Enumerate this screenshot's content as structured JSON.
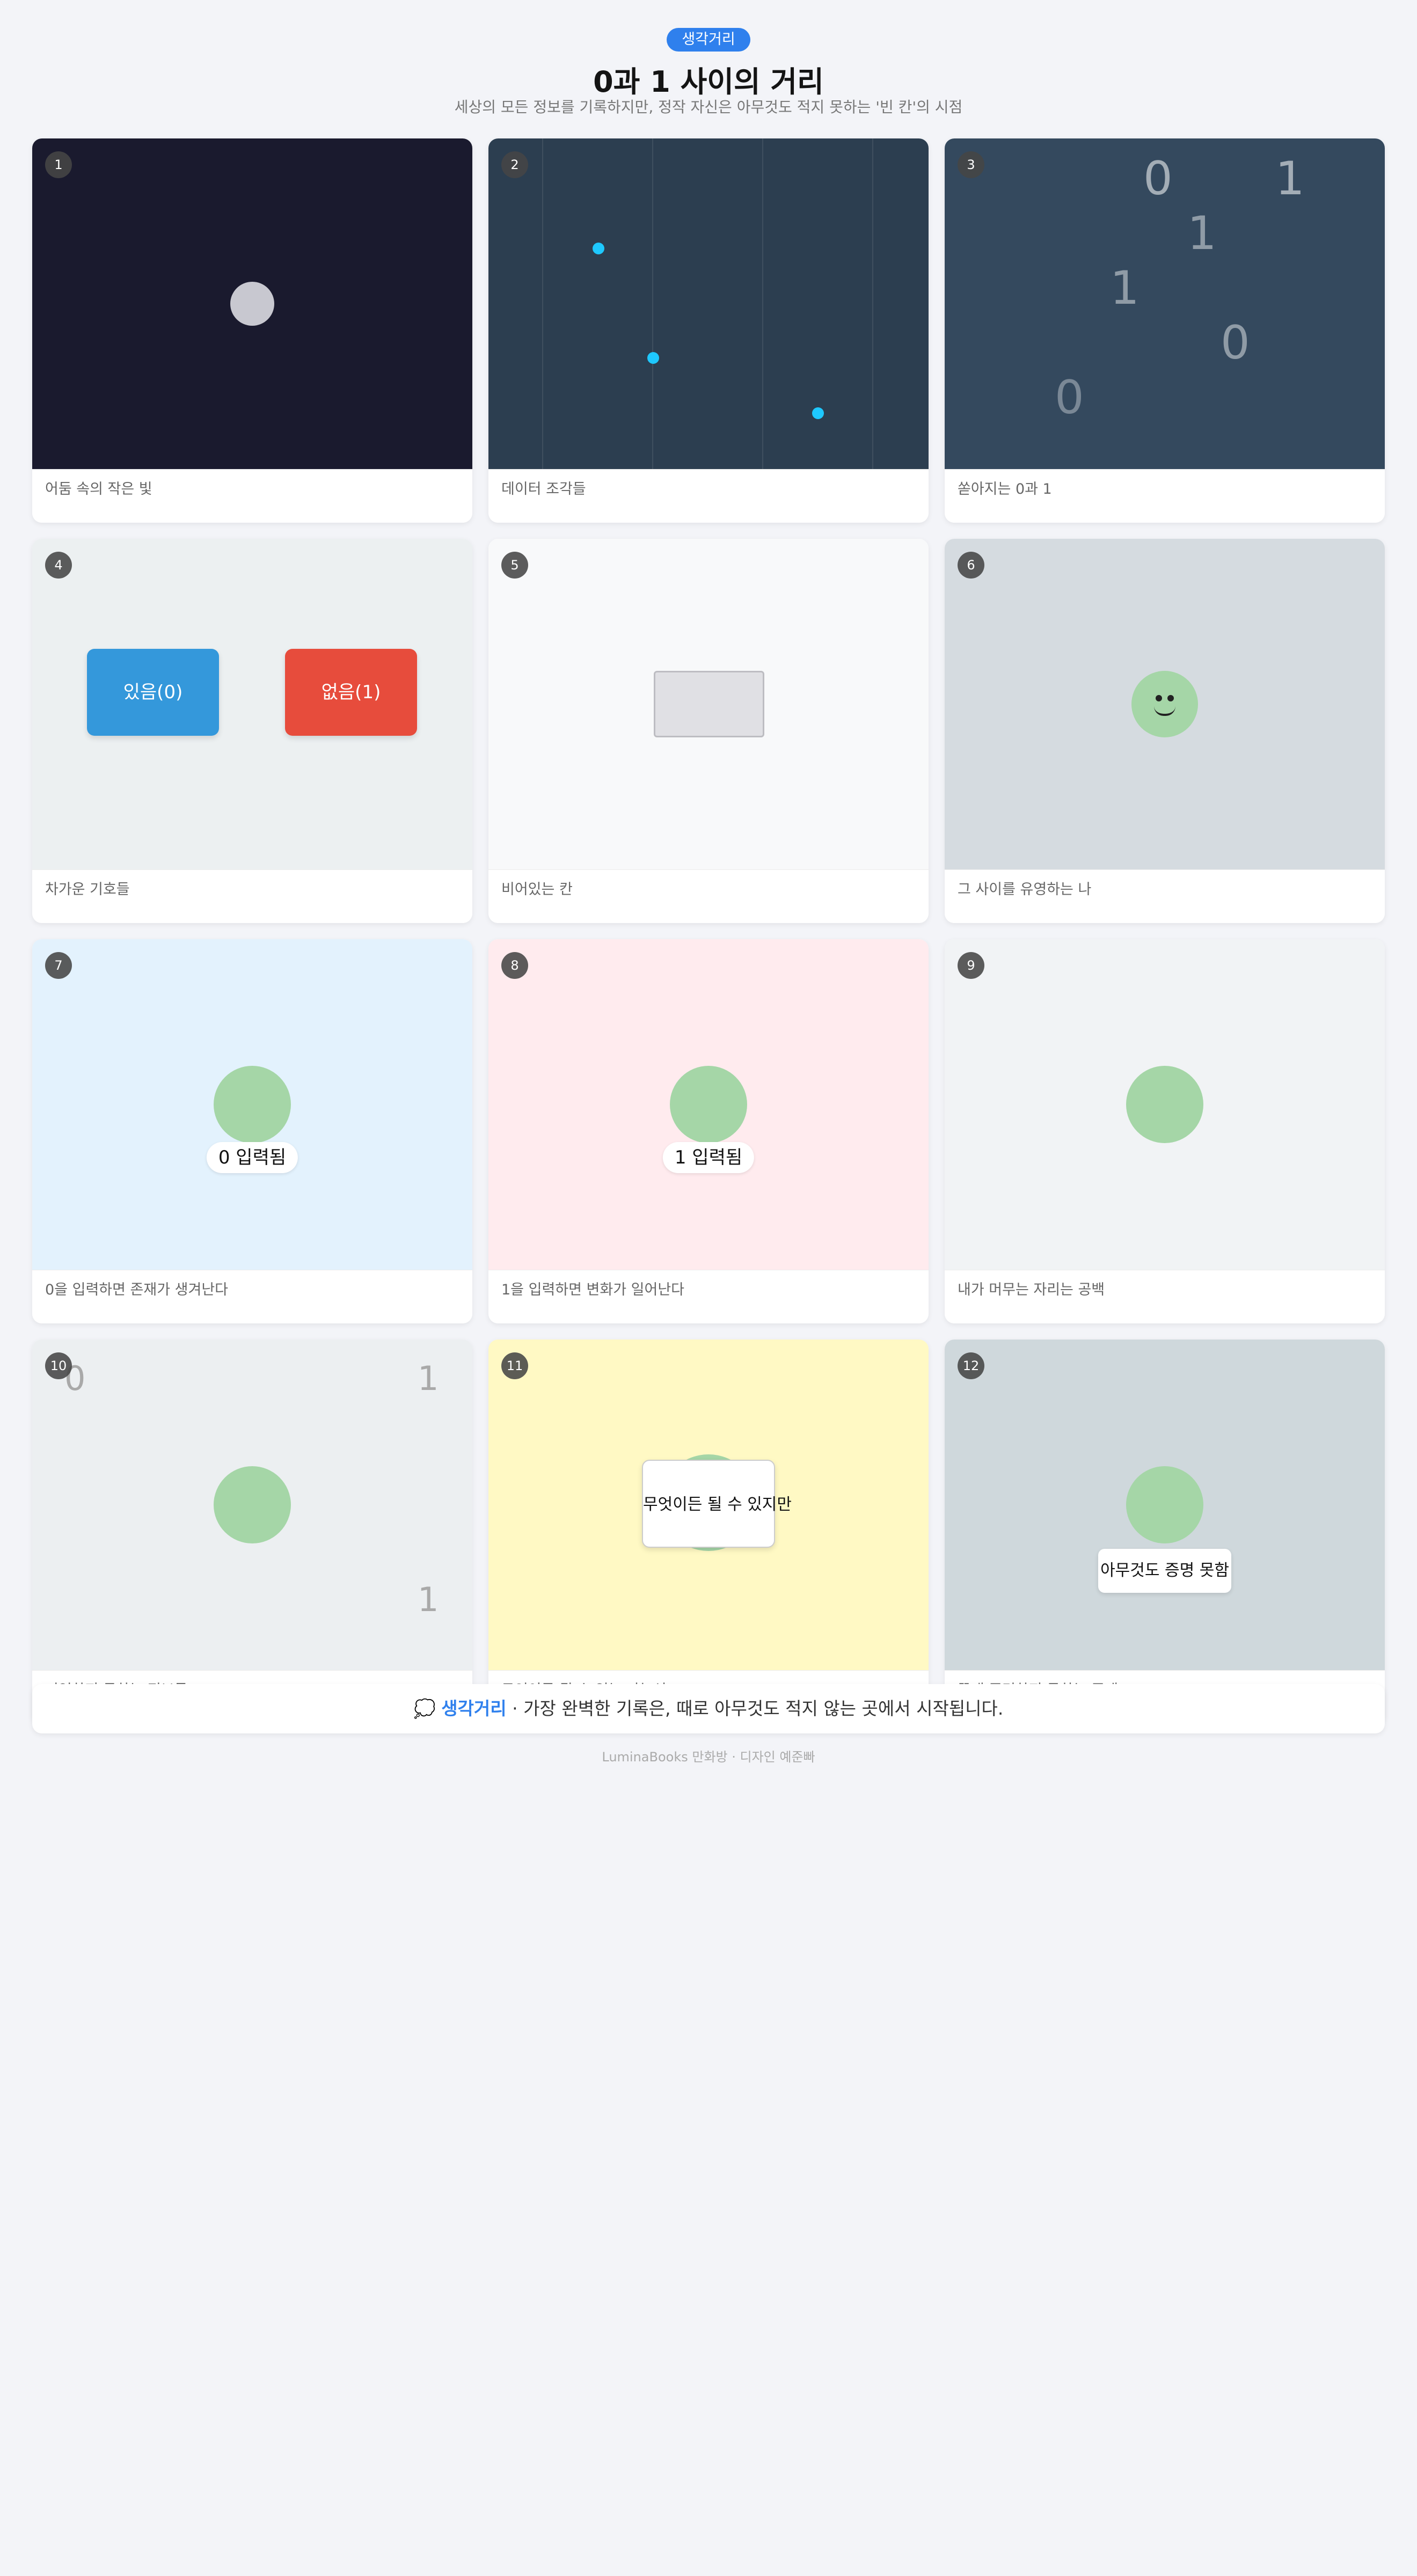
{
  "header": {
    "badge": "생각거리",
    "title": "0과 1 사이의 거리",
    "subtitle": "세상의 모든 정보를 기록하지만, 정작 자신은 아무것도 적지 못하는 '빈 칸'의 시점"
  },
  "panels": [
    {
      "num": "1",
      "caption": "어둠 속의 작은 빛"
    },
    {
      "num": "2",
      "caption": "데이터 조각들"
    },
    {
      "num": "3",
      "caption": "쏟아지는 0과 1",
      "digits": [
        "0",
        "1",
        "1",
        "1",
        "0",
        "0"
      ]
    },
    {
      "num": "4",
      "caption": "차가운 기호들",
      "left_button": "있음(0)",
      "right_button": "없음(1)"
    },
    {
      "num": "5",
      "caption": "비어있는 칸"
    },
    {
      "num": "6",
      "caption": "그 사이를 유영하는 나"
    },
    {
      "num": "7",
      "caption": "0을 입력하면 존재가 생겨난다",
      "chip": "0 입력됨"
    },
    {
      "num": "8",
      "caption": "1을 입력하면 변화가 일어난다",
      "chip": "1 입력됨"
    },
    {
      "num": "9",
      "caption": "내가 머무는 자리는 공백"
    },
    {
      "num": "10",
      "caption": "기억하지 못하는 정보들",
      "digits": [
        "0",
        "1",
        "1"
      ]
    },
    {
      "num": "11",
      "caption": "무엇이든 될 수 있는 가능성",
      "chip": "무엇이든 될 수 있지만"
    },
    {
      "num": "12",
      "caption": "끝내 증명하지 못하는 존재",
      "chip": "아무것도 증명 못함"
    }
  ],
  "footer": {
    "icon": "speech-bubble-icon",
    "icon_glyph": "💭",
    "accent": "생각거리",
    "text": " · 가장 완벽한 기록은, 때로 아무것도 적지 않는 곳에서 시작됩니다.",
    "credit": "LuminaBooks 만화방 · 디자인 예준빠"
  },
  "colors": {
    "accent": "#2f80ed",
    "character": "#a5d6a7",
    "dark_bg": "#1a1a2e",
    "slate_bg": "#2c3e50",
    "blue_button": "#3498db",
    "red_button": "#e74c3c",
    "data_dot": "#1ec8ff"
  }
}
